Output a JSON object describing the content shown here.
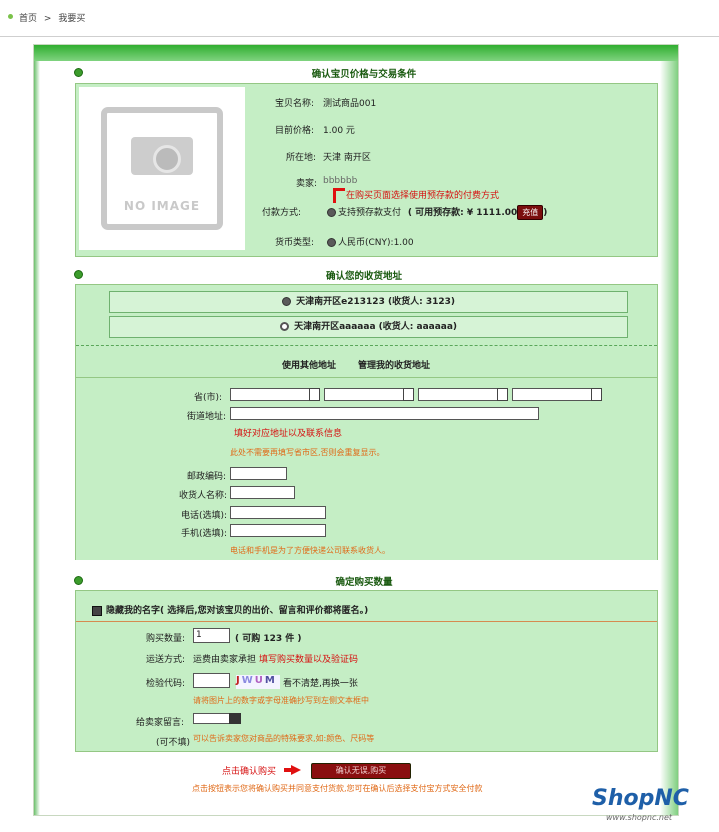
{
  "breadcrumb": {
    "home": "首页",
    "separator": ">",
    "current": "我要买"
  },
  "section1": {
    "title": "确认宝贝价格与交易条件",
    "no_image": "NO IMAGE",
    "name_label": "宝贝名称:",
    "name_value": "测试商品001",
    "price_label": "目前价格:",
    "price_value": "1.00 元",
    "location_label": "所在地:",
    "location_value": "天津 南开区",
    "seller_label": "卖家:",
    "seller_value": "bbbbbb",
    "payment_hint": "在购买页面选择使用预存款的付费方式",
    "payment_label": "付款方式:",
    "payment_value": "支持预存款支付",
    "balance_text": "( 可用预存款: ¥ 1111.00",
    "balance_close": ")",
    "recharge_button": "充值",
    "currency_label": "货币类型:",
    "currency_value": "人民币(CNY):1.00"
  },
  "section2": {
    "title": "确认您的收货地址",
    "addresses": [
      {
        "text": "天津南开区e213123 (收货人: 3123)",
        "selected": true
      },
      {
        "text": "天津南开区aaaaaa (收货人: aaaaaa)",
        "selected": false
      }
    ],
    "other_address": "使用其他地址",
    "manage_address": "管理我的收货地址",
    "province_label": "省(市):",
    "street_label": "街道地址:",
    "fill_hint": "填好对应地址以及联系信息",
    "street_note": "此处不需要再填写省市区,否则会重复显示。",
    "postcode_label": "邮政编码:",
    "receiver_label": "收货人名称:",
    "phone_label": "电话(选填):",
    "mobile_label": "手机(选填):",
    "contact_note": "电话和手机是为了方便快递公司联系收货人。"
  },
  "section3": {
    "title": "确定购买数量",
    "anon_label": "隐藏我的名字",
    "anon_note": "( 选择后,您对该宝贝的出价、留言和评价都将匿名。)",
    "qty_label": "购买数量:",
    "qty_value": "1",
    "qty_available": "( 可购  123 件 )",
    "shipping_label": "运送方式:",
    "shipping_value": "运费由卖家承担",
    "qty_hint": "填写购买数量以及验证码",
    "captcha_label": "检验代码:",
    "captcha_chars": [
      "J",
      "W",
      "U",
      "M"
    ],
    "captcha_refresh": "看不清楚,再换一张",
    "captcha_note": "请将图片上的数字或字母准确抄写到左侧文本框中",
    "message_label": "给卖家留言:",
    "message_optional": "(可不填)",
    "message_note": "可以告诉卖家您对商品的特殊要求,如:颜色、尺码等"
  },
  "confirm": {
    "hint": "点击确认购买",
    "button": "确认无误,购买",
    "note": "点击按钮表示您将确认购买并同意支付货款,您可在确认后选择支付宝方式安全付款"
  },
  "brand": {
    "name": "ShopNC",
    "url": "www.shopnc.net"
  },
  "colors": {
    "accent_green": "#3c9c2c",
    "panel_green": "#c5eec5",
    "alert_red": "#d61010",
    "note_orange": "#e06a18"
  }
}
